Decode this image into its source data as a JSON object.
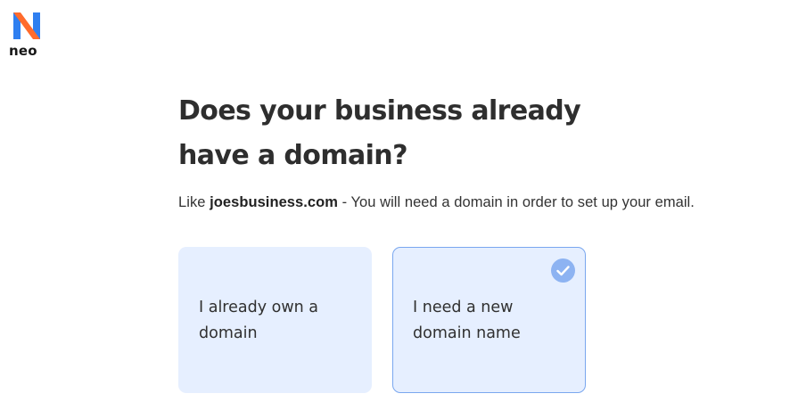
{
  "brand": {
    "name": "neo"
  },
  "question": {
    "title": "Does your business already have a domain?",
    "subtitle_prefix": "Like ",
    "subtitle_example": "joesbusiness.com",
    "subtitle_suffix": " - You will need a domain in order to set up your email."
  },
  "options": [
    {
      "label": "I already own a domain",
      "selected": false
    },
    {
      "label": "I need a new domain name",
      "selected": true
    }
  ],
  "colors": {
    "card_background": "#e6efff",
    "selected_border": "#7aa7ef",
    "check": "#8db3f2",
    "logo_blue": "#2f7ff0",
    "logo_orange": "#ff6b2c"
  },
  "icons": {
    "logo": "neo-logo-icon",
    "selected": "checkmark-circle-icon"
  }
}
